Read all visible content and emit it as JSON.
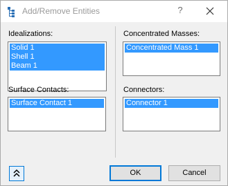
{
  "window": {
    "title": "Add/Remove Entities",
    "help_label": "?",
    "icons": {
      "app": "entity-tree-icon",
      "close": "close-icon",
      "expand": "double-chevron-up-icon"
    }
  },
  "idealizations": {
    "label": "Idealizations:",
    "items": [
      {
        "label": "Solid 1",
        "selected": true
      },
      {
        "label": "Shell 1",
        "selected": true
      },
      {
        "label": "Beam 1",
        "selected": true
      }
    ]
  },
  "concentrated_masses": {
    "label": "Concentrated Masses:",
    "items": [
      {
        "label": "Concentrated Mass 1",
        "selected": true
      }
    ]
  },
  "surface_contacts": {
    "label": "Surface Contacts:",
    "items": [
      {
        "label": "Surface Contact 1",
        "selected": true
      }
    ]
  },
  "connectors": {
    "label": "Connectors:",
    "items": [
      {
        "label": "Connector 1",
        "selected": true
      }
    ]
  },
  "footer": {
    "ok_label": "OK",
    "cancel_label": "Cancel"
  },
  "colors": {
    "selection": "#3399ff",
    "accent": "#0078d7",
    "dialog_bg": "#f0f0f0"
  }
}
